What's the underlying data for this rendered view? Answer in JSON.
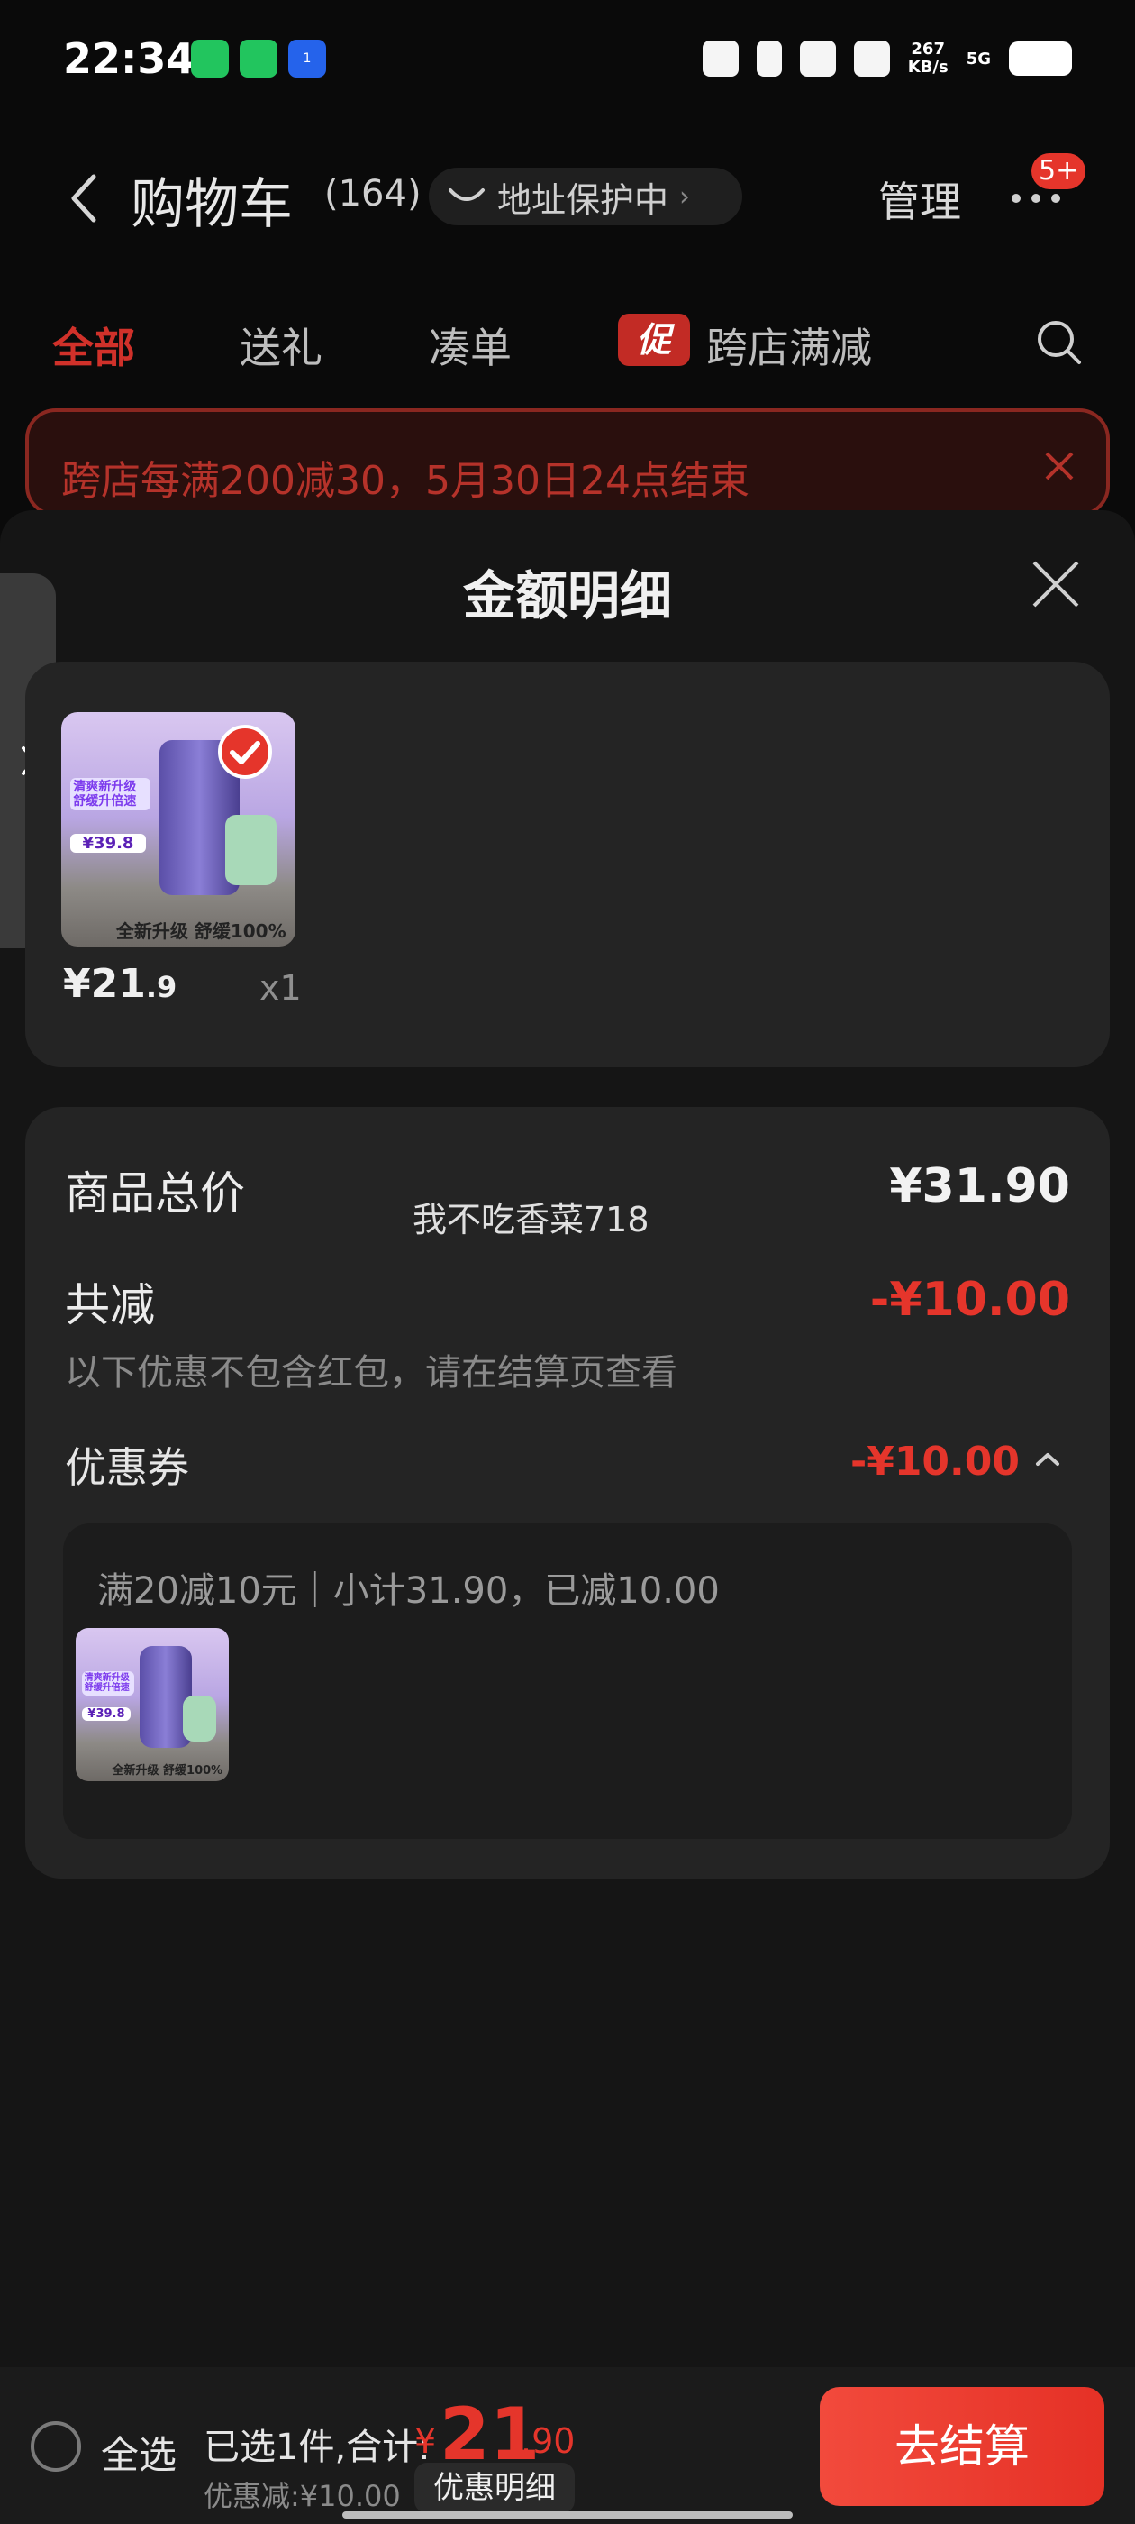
{
  "status_bar": {
    "time": "22:34",
    "speed_value": "267",
    "speed_unit": "KB/s",
    "network": "5G",
    "radio_badge": "1"
  },
  "header": {
    "title": "购物车",
    "count": "(164)",
    "address_protection": "地址保护中",
    "address_arrow": "›",
    "manage": "管理",
    "badge": "5+"
  },
  "tabs": {
    "all": "全部",
    "gift": "送礼",
    "bundle": "凑单",
    "promo_tag": "促",
    "cross_store": "跨店满减"
  },
  "promo_banner": {
    "text": "跨店每满200减30，5月30日24点结束"
  },
  "sheet": {
    "title": "金额明细",
    "item": {
      "price_int": "¥21",
      "price_dec": ".9",
      "qty": "x1",
      "thumb_label": "清爽新升级 舒缓升倍速",
      "thumb_price": "¥39.8",
      "thumb_slogan": "全新升级 舒缓100%"
    },
    "summary": {
      "total_label": "商品总价",
      "total_value": "¥31.90",
      "watermark": "我不吃香菜718",
      "discount_label": "共减",
      "discount_value": "-¥10.00",
      "discount_note": "以下优惠不包含红包，请在结算页查看",
      "coupon_label": "优惠券",
      "coupon_value": "-¥10.00",
      "coupon_detail": "满20减10元｜小计31.90，已减10.00"
    }
  },
  "bottom_bar": {
    "select_all": "全选",
    "selected": "已选1件,合计:",
    "currency": "¥",
    "total_int": "21",
    "total_dec": ".90",
    "saved": "优惠减:¥10.00",
    "detail": "优惠明细",
    "checkout": "去结算"
  },
  "colors": {
    "accent": "#e5352b",
    "background": "#0a0a0a",
    "card": "#242424"
  },
  "icons": [
    "back-icon",
    "search-icon",
    "close-icon",
    "more-icon",
    "truck-icon",
    "chevron-up-icon",
    "check-icon",
    "chevron-right-icon"
  ]
}
